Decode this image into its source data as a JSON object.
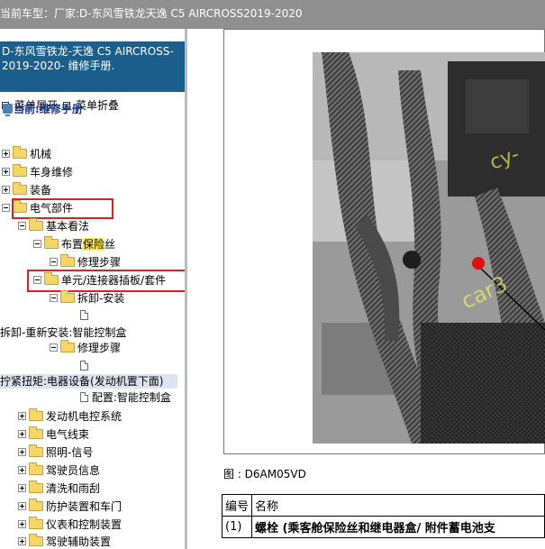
{
  "topbar": {
    "label": "当前车型：",
    "value": "厂家:D-东风雪铁龙天逸 C5 AIRCROSS2019-2020"
  },
  "sidebar": {
    "manual_title": "D-东风雪铁龙-天逸 C5 AIRCROSS-2019-2020- 维修手册.",
    "expand_label": "菜单展开",
    "collapse_label": "菜单折叠",
    "current_label": "当前:维修手册",
    "tree": {
      "mechanical": "机械",
      "body_repair": "车身维修",
      "equipment": "装备",
      "electrical": "电气部件",
      "basic_view": "基本看法",
      "fuse_layout_pre": "布置",
      "fuse_layout_hl": "保险",
      "fuse_layout_post": "丝",
      "repair_steps_1": "修理步骤",
      "unit_connector": "单元/连接器插板/套件",
      "remove_install": "拆卸-安装",
      "remove_reinstall_box": "拆卸-重新安装:智能控制盒",
      "repair_steps_2": "修理步骤",
      "torque_spec": "拧紧扭矩:电器设备(发动机置下面)",
      "config_box": "配置:智能控制盒",
      "engine_ecu": "发动机电控系统",
      "harness": "电气线束",
      "lighting_signal": "照明-信号",
      "driver_info": "驾驶员信息",
      "wash_wipe": "清洗和雨刮",
      "protect_doors": "防护装置和车门",
      "instruments_controls": "仪表和控制装置",
      "driving_assist": "驾驶辅助装置"
    }
  },
  "figure": {
    "caption": "图 : D6AM05VD"
  },
  "table": {
    "col_number": "编号",
    "col_name": "名称",
    "rows": [
      {
        "number": "(1)",
        "name": "螺栓 (乘客舱保险丝和继电器盒/ 附件蓄电池支"
      }
    ]
  }
}
